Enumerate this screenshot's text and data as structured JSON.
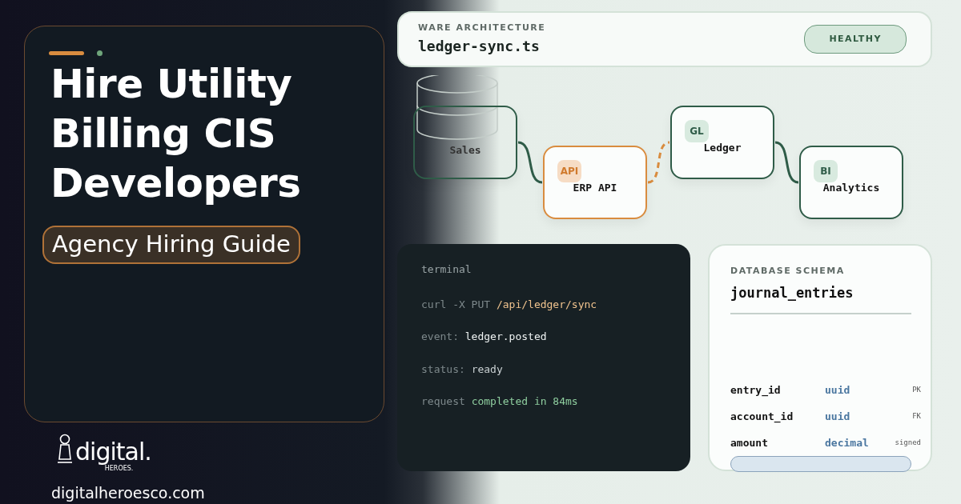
{
  "hero": {
    "title_lines": [
      "Hire Utility",
      "Billing CIS",
      "Developers"
    ],
    "tag": "Agency Hiring Guide",
    "brand": {
      "logo": "digital.",
      "logo_sub": "HEROES.",
      "url": "digitalheroesco.com"
    }
  },
  "architecture": {
    "label": "WARE ARCHITECTURE",
    "file": "ledger-sync.ts",
    "status": "HEALTHY",
    "nodes": [
      {
        "kind": "plain",
        "label": "Sales"
      },
      {
        "kind": "accent",
        "badge": "API",
        "label": "ERP API"
      },
      {
        "kind": "normal",
        "badge": "GL",
        "label": "Ledger"
      },
      {
        "kind": "normal",
        "badge": "BI",
        "label": "Analytics"
      }
    ],
    "links": [
      {
        "kind": "solid"
      },
      {
        "kind": "dashed"
      },
      {
        "kind": "solid"
      }
    ]
  },
  "terminal": {
    "title": "terminal",
    "lines": [
      {
        "key": "curl -X PUT",
        "value": "/api/ledger/sync",
        "kind": "path"
      },
      {
        "key": "event:",
        "value": "ledger.posted",
        "kind": "plain"
      },
      {
        "key": "status:",
        "value": "ready",
        "kind": "muted"
      },
      {
        "key": "request",
        "value": "completed in 84ms",
        "kind": "success"
      }
    ]
  },
  "schema": {
    "label": "DATABASE SCHEMA",
    "table": "journal_entries",
    "fields": [
      {
        "name": "entry_id",
        "type": "uuid",
        "note": "PK"
      },
      {
        "name": "account_id",
        "type": "uuid",
        "note": "FK"
      },
      {
        "name": "amount",
        "type": "decimal",
        "note": "signed"
      }
    ]
  }
}
